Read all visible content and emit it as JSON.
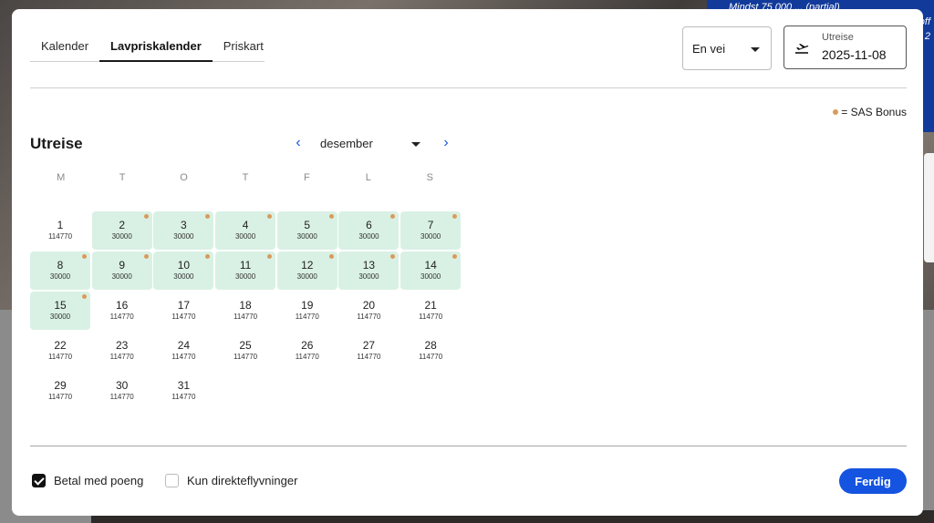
{
  "background": {
    "promo_lines": [
      "Mindst 75 000 ... (partial)",
      "off",
      "d 2"
    ]
  },
  "tabs": [
    {
      "label": "Kalender",
      "active": false
    },
    {
      "label": "Lavpriskalender",
      "active": true
    },
    {
      "label": "Priskart",
      "active": false
    }
  ],
  "trip_type": {
    "value": "En vei"
  },
  "departure_field": {
    "label": "Utreise",
    "value": "2025-11-08",
    "icon": "plane-takeoff-icon"
  },
  "legend": {
    "text": "= SAS Bonus",
    "color": "#d99b5c"
  },
  "calendar": {
    "title": "Utreise",
    "month": "desember",
    "weekdays": [
      "M",
      "T",
      "O",
      "T",
      "F",
      "L",
      "S"
    ],
    "days": [
      {
        "day": "1",
        "price": "114770",
        "bonus": false
      },
      {
        "day": "2",
        "price": "30000",
        "bonus": true
      },
      {
        "day": "3",
        "price": "30000",
        "bonus": true
      },
      {
        "day": "4",
        "price": "30000",
        "bonus": true
      },
      {
        "day": "5",
        "price": "30000",
        "bonus": true
      },
      {
        "day": "6",
        "price": "30000",
        "bonus": true
      },
      {
        "day": "7",
        "price": "30000",
        "bonus": true
      },
      {
        "day": "8",
        "price": "30000",
        "bonus": true
      },
      {
        "day": "9",
        "price": "30000",
        "bonus": true
      },
      {
        "day": "10",
        "price": "30000",
        "bonus": true
      },
      {
        "day": "11",
        "price": "30000",
        "bonus": true
      },
      {
        "day": "12",
        "price": "30000",
        "bonus": true
      },
      {
        "day": "13",
        "price": "30000",
        "bonus": true
      },
      {
        "day": "14",
        "price": "30000",
        "bonus": true
      },
      {
        "day": "15",
        "price": "30000",
        "bonus": true
      },
      {
        "day": "16",
        "price": "114770",
        "bonus": false
      },
      {
        "day": "17",
        "price": "114770",
        "bonus": false
      },
      {
        "day": "18",
        "price": "114770",
        "bonus": false
      },
      {
        "day": "19",
        "price": "114770",
        "bonus": false
      },
      {
        "day": "20",
        "price": "114770",
        "bonus": false
      },
      {
        "day": "21",
        "price": "114770",
        "bonus": false
      },
      {
        "day": "22",
        "price": "114770",
        "bonus": false
      },
      {
        "day": "23",
        "price": "114770",
        "bonus": false
      },
      {
        "day": "24",
        "price": "114770",
        "bonus": false
      },
      {
        "day": "25",
        "price": "114770",
        "bonus": false
      },
      {
        "day": "26",
        "price": "114770",
        "bonus": false
      },
      {
        "day": "27",
        "price": "114770",
        "bonus": false
      },
      {
        "day": "28",
        "price": "114770",
        "bonus": false
      },
      {
        "day": "29",
        "price": "114770",
        "bonus": false
      },
      {
        "day": "30",
        "price": "114770",
        "bonus": false
      },
      {
        "day": "31",
        "price": "114770",
        "bonus": false
      }
    ]
  },
  "options": {
    "pay_with_points": {
      "label": "Betal med poeng",
      "checked": true
    },
    "direct_only": {
      "label": "Kun direkteflyvninger",
      "checked": false
    }
  },
  "done_button": {
    "label": "Ferdig",
    "color": "#1554e0"
  }
}
